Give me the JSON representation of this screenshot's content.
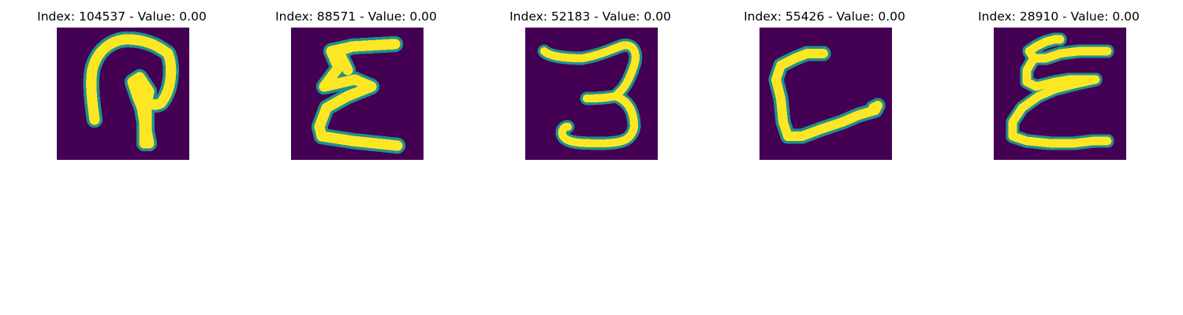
{
  "colormap": {
    "background": "#440154",
    "stroke_edge": "#21918c",
    "stroke_mid": "#7ad151",
    "stroke_core": "#fde725"
  },
  "panels": [
    {
      "title": "Index: 104537 - Value: 0.00",
      "glyph_icon": "handwritten-glyph-icon"
    },
    {
      "title": "Index: 88571 - Value: 0.00",
      "glyph_icon": "handwritten-glyph-icon"
    },
    {
      "title": "Index: 52183 - Value: 0.00",
      "glyph_icon": "handwritten-glyph-icon"
    },
    {
      "title": "Index: 55426 - Value: 0.00",
      "glyph_icon": "handwritten-glyph-icon"
    },
    {
      "title": "Index: 28910 - Value: 0.00",
      "glyph_icon": "handwritten-glyph-icon"
    }
  ]
}
